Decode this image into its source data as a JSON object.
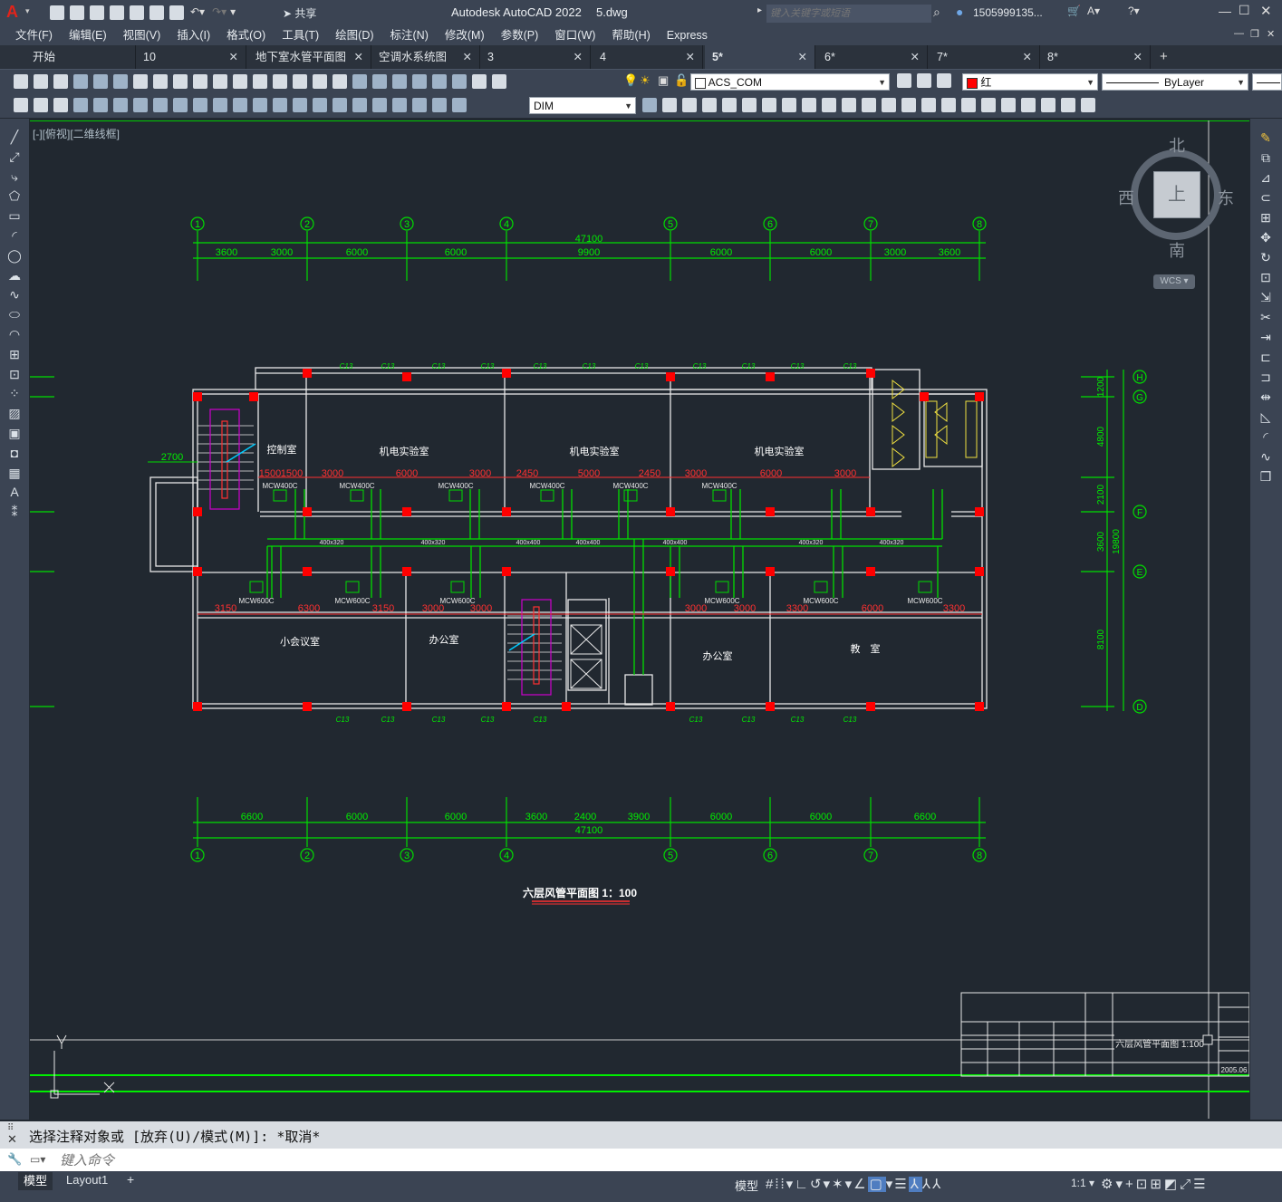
{
  "app": {
    "title": "Autodesk AutoCAD 2022",
    "file": "5.dwg",
    "search_placeholder": "键入关键字或短语",
    "user": "1505999135...",
    "share_label": "共享"
  },
  "menu": [
    "文件(F)",
    "编辑(E)",
    "视图(V)",
    "插入(I)",
    "格式(O)",
    "工具(T)",
    "绘图(D)",
    "标注(N)",
    "修改(M)",
    "参数(P)",
    "窗口(W)",
    "帮助(H)",
    "Express"
  ],
  "tabs": [
    {
      "label": "开始",
      "closable": false
    },
    {
      "label": "10",
      "closable": true
    },
    {
      "label": "地下室水管平面图",
      "closable": true
    },
    {
      "label": "空调水系统图",
      "closable": true
    },
    {
      "label": "3",
      "closable": true
    },
    {
      "label": "4",
      "closable": true
    },
    {
      "label": "5*",
      "closable": true,
      "active": true
    },
    {
      "label": "6*",
      "closable": true
    },
    {
      "label": "7*",
      "closable": true
    },
    {
      "label": "8*",
      "closable": true
    }
  ],
  "toolbar": {
    "layer": "ACS_COM",
    "color": "红",
    "linetype": "ByLayer",
    "dimstyle": "DIM"
  },
  "viewport": {
    "label": "[-][俯视][二维线框]",
    "compass": {
      "north": "北",
      "south": "南",
      "east": "东",
      "west": "西",
      "center": "上",
      "wcs": "WCS"
    }
  },
  "drawing": {
    "title": "六层风管平面图 1：100",
    "axes": [
      "1",
      "2",
      "3",
      "4",
      "5",
      "6",
      "7",
      "8"
    ],
    "row_axes": [
      "H",
      "G",
      "F",
      "E",
      "D"
    ],
    "top_total": "47100",
    "top_sub": "9900",
    "top_dims": [
      "3600",
      "3000",
      "6000",
      "6000",
      "6000",
      "6000",
      "3000",
      "3600"
    ],
    "bottom_total": "47100",
    "bottom_dims": [
      "6600",
      "6000",
      "6000",
      "3600",
      "2400",
      "3900",
      "6000",
      "6000",
      "6600"
    ],
    "right_dims": [
      "1200",
      "4800",
      "2100",
      "3600",
      "8100"
    ],
    "right_total": "19800",
    "rooms": [
      "控制室",
      "机电实验室",
      "机电实验室",
      "机电实验室",
      "小会议室",
      "办公室",
      "办公室",
      "教　室"
    ],
    "left_dim": "2700",
    "red_dims_top": [
      "1500",
      "1500",
      "3000",
      "6000",
      "3000",
      "2450",
      "5000",
      "2450",
      "3000",
      "6000",
      "3000"
    ],
    "red_dims_bottom": [
      "3150",
      "6300",
      "3150",
      "3000",
      "3000",
      "3000",
      "3000",
      "3300",
      "6000",
      "3300"
    ],
    "fan_top": [
      "MCW400C",
      "MCW400C",
      "MCW400C",
      "MCW400C",
      "MCW400C",
      "MCW400C"
    ],
    "fan_bottom": [
      "MCW600C",
      "MCW600C",
      "MCW600C",
      "MCW600C",
      "MCW600C",
      "MCW600C"
    ],
    "duct_sizes": [
      "400x320",
      "400x320",
      "400x400",
      "400x400",
      "400x400",
      "400x320",
      "400x320"
    ],
    "window_label": "C13",
    "title_block": {
      "name": "六层风管平面图 1:100",
      "date": "2005.06"
    }
  },
  "command": {
    "history": "选择注释对象或 [放弃(U)/模式(M)]: *取消*",
    "placeholder": "键入命令"
  },
  "layout_tabs": [
    "模型",
    "Layout1"
  ],
  "status": {
    "model": "模型",
    "scale": "1:1"
  }
}
